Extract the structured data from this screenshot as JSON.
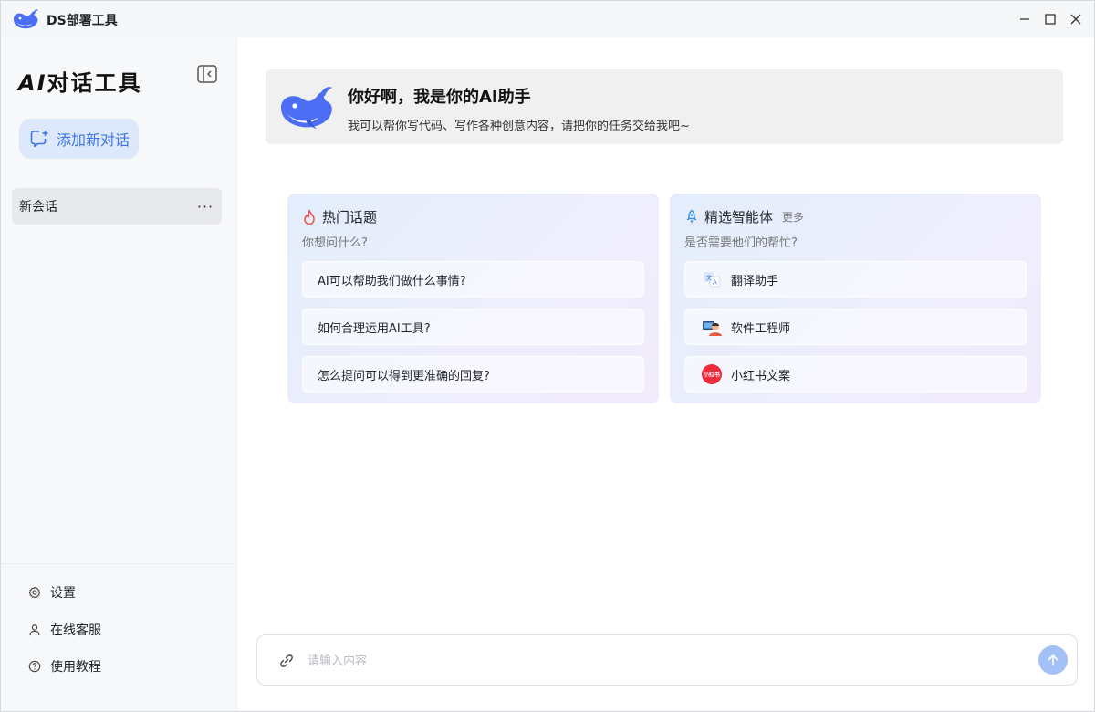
{
  "window": {
    "title": "DS部署工具"
  },
  "sidebar": {
    "title_prefix": "AI",
    "title_rest": "对话工具",
    "new_chat_label": "添加新对话",
    "sessions": [
      {
        "label": "新会话",
        "more": "···"
      }
    ],
    "bottom_items": [
      {
        "label": "设置",
        "icon": "gear-icon"
      },
      {
        "label": "在线客服",
        "icon": "user-icon"
      },
      {
        "label": "使用教程",
        "icon": "help-circle-icon"
      }
    ]
  },
  "main": {
    "greeting": {
      "title": "你好啊，我是你的AI助手",
      "subtitle": "我可以帮你写代码、写作各种创意内容，请把你的任务交给我吧~"
    },
    "hot_topics": {
      "title": "热门话题",
      "subtitle": "你想问什么?",
      "items": [
        "AI可以帮助我们做什么事情?",
        "如何合理运用AI工具?",
        "怎么提问可以得到更准确的回复?"
      ]
    },
    "agents": {
      "title": "精选智能体",
      "more": "更多",
      "subtitle": "是否需要他们的帮忙?",
      "items": [
        {
          "label": "翻译助手",
          "icon": "translate-icon"
        },
        {
          "label": "软件工程师",
          "icon": "engineer-icon"
        },
        {
          "label": "小红书文案",
          "icon": "xiaohongshu-icon",
          "icon_text": "小红书"
        }
      ]
    },
    "input": {
      "placeholder": "请输入内容",
      "value": ""
    }
  },
  "colors": {
    "accent": "#3d74e8",
    "new_chat_bg": "#dde8fb",
    "send_button": "#a3c1f7",
    "whale": "#4b6ef5",
    "flame": "#f0504a",
    "xiaohongshu": "#ee2a3d"
  }
}
